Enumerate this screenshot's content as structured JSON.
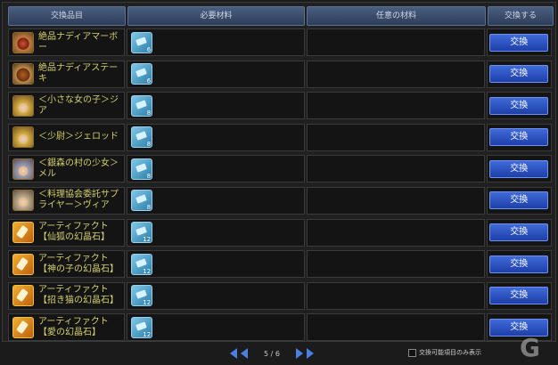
{
  "header": {
    "col_item": "交換品目",
    "col_required": "必要材料",
    "col_optional": "任意の材料",
    "col_exchange": "交換する"
  },
  "rows": [
    {
      "name": "絶品ナディアマーボー",
      "icon": "mapo-dish-icon",
      "badge": "",
      "material_count": "6",
      "button": "交換"
    },
    {
      "name": "絶品ナディアステーキ",
      "icon": "steak-dish-icon",
      "badge": "",
      "material_count": "6",
      "button": "交換"
    },
    {
      "name": "＜小さな女の子＞ジア",
      "icon": "girl-portrait-icon",
      "badge": "",
      "material_count": "8",
      "button": "交換"
    },
    {
      "name": "＜少尉＞ジェロッド",
      "icon": "lieutenant-portrait-icon",
      "badge": "",
      "material_count": "8",
      "button": "交換"
    },
    {
      "name": "＜銀森の村の少女＞メル",
      "icon": "silver-haired-girl-portrait-icon",
      "badge": "",
      "material_count": "8",
      "button": "交換"
    },
    {
      "name": "＜料理協会委託サプライヤー＞ヴィア",
      "icon": "supplier-portrait-icon",
      "badge": "",
      "material_count": "8",
      "button": "交換"
    },
    {
      "name": "アーティファクト【仙狐の幻晶石】",
      "icon": "artifact-crystal-icon",
      "badge": "",
      "material_count": "12",
      "button": "交換"
    },
    {
      "name": "アーティファクト【神の子の幻晶石】",
      "icon": "artifact-crystal-icon",
      "badge": "",
      "material_count": "12",
      "button": "交換"
    },
    {
      "name": "アーティファクト【招き猫の幻晶石】",
      "icon": "artifact-crystal-icon",
      "badge": "",
      "material_count": "12",
      "button": "交換"
    },
    {
      "name": "アーティファクト【愛の幻晶石】",
      "icon": "artifact-crystal-icon",
      "badge": "",
      "material_count": "12",
      "button": "交換"
    }
  ],
  "pager": {
    "page_text": "5 / 6"
  },
  "filter": {
    "label": "交換可能項目のみ表示",
    "checked": false
  },
  "watermark": {
    "text": "G"
  },
  "colors": {
    "accent_button": "#2a52c8",
    "item_name": "#d4d070",
    "header": "#3c4f70"
  }
}
